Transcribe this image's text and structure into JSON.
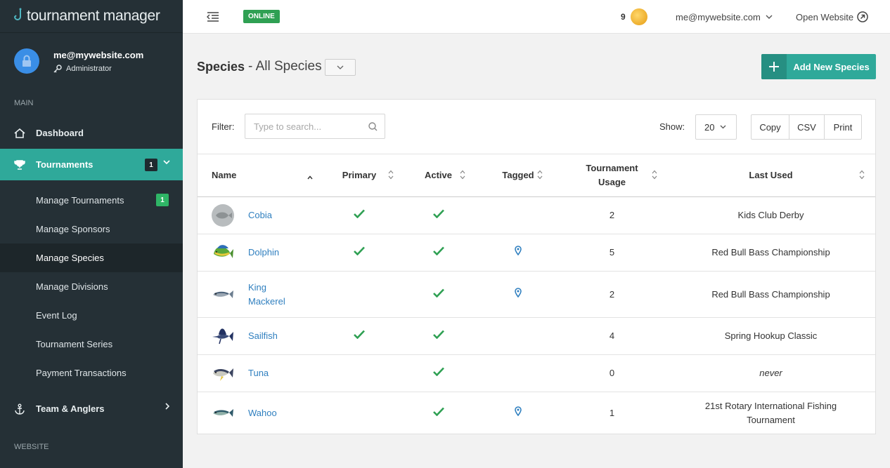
{
  "brand": {
    "name": "tournament manager"
  },
  "user": {
    "email": "me@mywebsite.com",
    "role": "Administrator"
  },
  "nav": {
    "main_label": "MAIN",
    "dashboard": "Dashboard",
    "tournaments": "Tournaments",
    "tournaments_badge": "1",
    "sub_items": [
      {
        "label": "Manage Tournaments",
        "badge": "1"
      },
      {
        "label": "Manage Sponsors"
      },
      {
        "label": "Manage Species"
      },
      {
        "label": "Manage Divisions"
      },
      {
        "label": "Event Log"
      },
      {
        "label": "Tournament Series"
      },
      {
        "label": "Payment Transactions"
      }
    ],
    "team_anglers": "Team & Anglers",
    "website_label": "WEBSITE"
  },
  "topbar": {
    "status": "ONLINE",
    "coins": "9",
    "email": "me@mywebsite.com",
    "open_website": "Open Website"
  },
  "page": {
    "title": "Species",
    "subtitle": "- All Species",
    "add_button": "Add New Species"
  },
  "toolbar": {
    "filter_label": "Filter:",
    "filter_placeholder": "Type to search...",
    "show_label": "Show:",
    "show_value": "20",
    "copy": "Copy",
    "csv": "CSV",
    "print": "Print"
  },
  "table": {
    "headers": {
      "name": "Name",
      "primary": "Primary",
      "active": "Active",
      "tagged": "Tagged",
      "usage_line1": "Tournament",
      "usage_line2": "Usage",
      "last_used": "Last Used"
    },
    "rows": [
      {
        "name": "Cobia",
        "primary": true,
        "active": true,
        "tagged": false,
        "usage": "2",
        "last_used": "Kids Club Derby",
        "img": "placeholder"
      },
      {
        "name": "Dolphin",
        "primary": true,
        "active": true,
        "tagged": true,
        "usage": "5",
        "last_used": "Red Bull Bass Championship",
        "img": "dolphin"
      },
      {
        "name_line1": "King",
        "name_line2": "Mackerel",
        "primary": false,
        "active": true,
        "tagged": true,
        "usage": "2",
        "last_used": "Red Bull Bass Championship",
        "img": "mackerel"
      },
      {
        "name": "Sailfish",
        "primary": true,
        "active": true,
        "tagged": false,
        "usage": "4",
        "last_used": "Spring Hookup Classic",
        "img": "sailfish"
      },
      {
        "name": "Tuna",
        "primary": false,
        "active": true,
        "tagged": false,
        "usage": "0",
        "last_used": "never",
        "img": "tuna"
      },
      {
        "name": "Wahoo",
        "primary": false,
        "active": true,
        "tagged": true,
        "usage": "1",
        "last_used_line1": "21st Rotary International Fishing",
        "last_used_line2": "Tournament",
        "img": "wahoo"
      }
    ]
  },
  "colors": {
    "accent": "#2fa99a",
    "sidebar": "#253036",
    "check": "#2fa053",
    "link": "#2f7fbf"
  }
}
